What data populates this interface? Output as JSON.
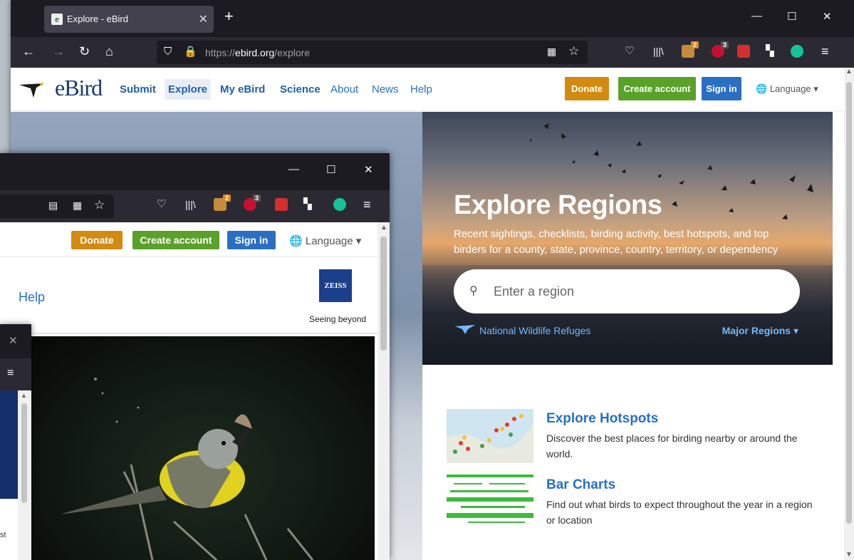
{
  "browser": {
    "tab_title": "Explore - eBird",
    "tab_favicon": "e",
    "url_prefix": "https://",
    "url_domain": "ebird.org",
    "url_path": "/explore",
    "ext_badges": [
      "2",
      "3"
    ]
  },
  "site": {
    "logo": "eBird",
    "nav": [
      "Submit",
      "Explore",
      "My eBird",
      "Science",
      "About",
      "News",
      "Help"
    ],
    "donate": "Donate",
    "create_account": "Create account",
    "sign_in": "Sign in",
    "language": "Language"
  },
  "hero": {
    "title": "Explore Regions",
    "subtitle": "Recent sightings, checklists, birding activity, best hotspots, and top birders for a county, state, province, country, territory, or dependency",
    "search_placeholder": "Enter a region",
    "nwr_link": "National Wildlife Refuges",
    "major_regions": "Major Regions ▾"
  },
  "features": [
    {
      "title": "Explore Hotspots",
      "desc": "Discover the best places for birding nearby or around the world."
    },
    {
      "title": "Bar Charts",
      "desc": "Find out what birds to expect throughout the year in a region or location"
    }
  ],
  "window2": {
    "donate": "Donate",
    "create_account": "Create account",
    "sign_in": "Sign in",
    "language": "Language",
    "help": "Help",
    "sponsor": "ZEISS",
    "sponsor_tagline": "Seeing beyond",
    "ext_badges": [
      "2",
      "3"
    ]
  },
  "window3": {
    "fragment": "st"
  },
  "colors": {
    "donate": "#d28a11",
    "create": "#5aa12a",
    "signin": "#2b6fc2",
    "link": "#2570c4"
  }
}
